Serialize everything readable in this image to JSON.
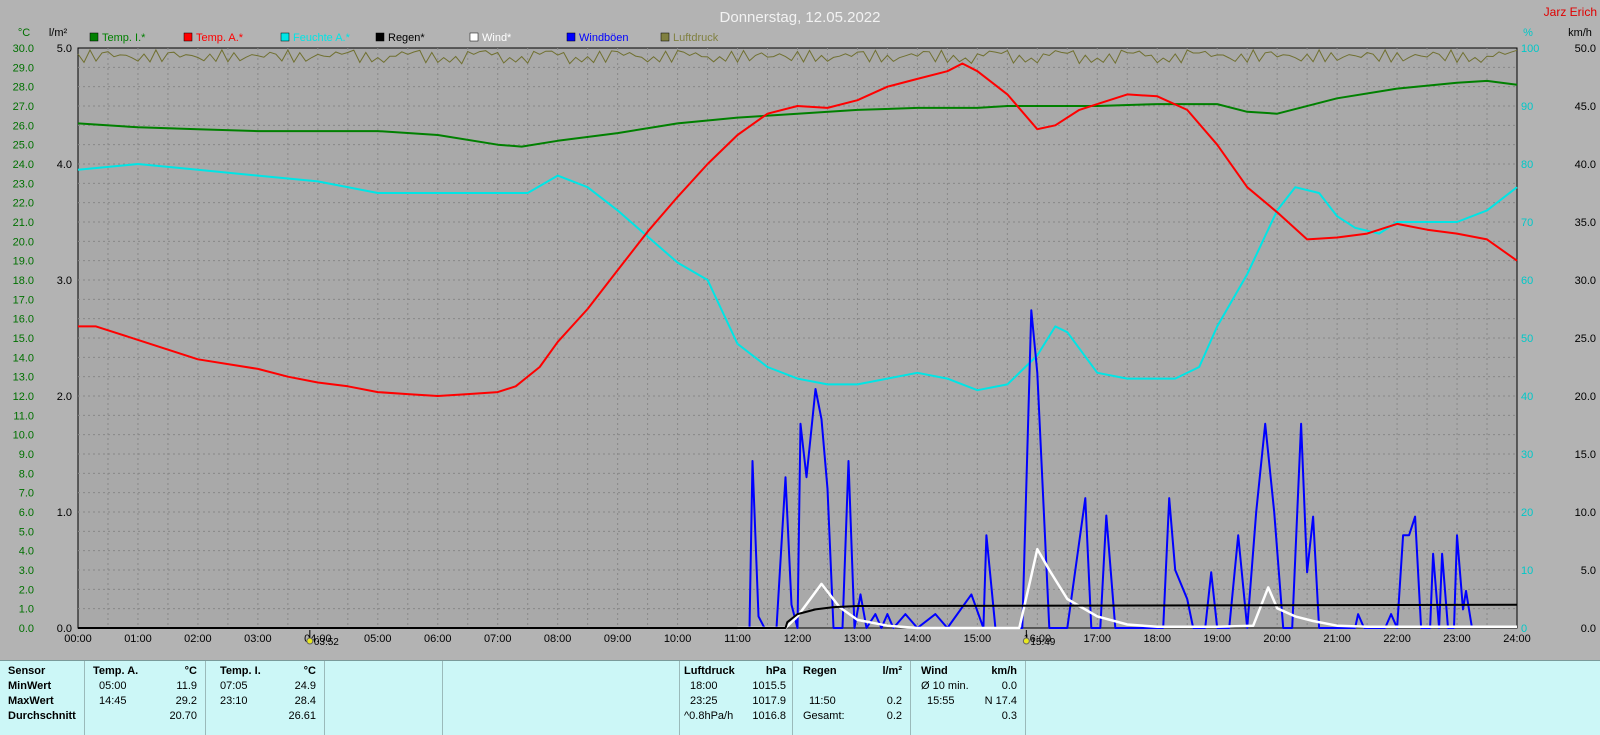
{
  "title": "Donnerstag, 12.05.2022",
  "author": "Jarz Erich",
  "units": {
    "temp": "°C",
    "rain": "l/m²",
    "humidity": "%",
    "wind": "km/h"
  },
  "legend": [
    {
      "label": "Temp. I.*",
      "color": "#008000"
    },
    {
      "label": "Temp. A.*",
      "color": "#ff0000"
    },
    {
      "label": "Feuchte A.*",
      "color": "#00e5e5"
    },
    {
      "label": "Regen*",
      "color": "#000000"
    },
    {
      "label": "Wind*",
      "color": "#ffffff"
    },
    {
      "label": "Windböen",
      "color": "#0000ff"
    },
    {
      "label": "Luftdruck",
      "color": "#808040"
    }
  ],
  "markers": [
    {
      "time": "03:52",
      "label": "03:52"
    },
    {
      "time": "15:49",
      "label": "15:49"
    }
  ],
  "chart_data": {
    "type": "line",
    "x_range": [
      "00:00",
      "24:00"
    ],
    "x_ticks": [
      "00:00",
      "01:00",
      "02:00",
      "03:00",
      "04:00",
      "05:00",
      "06:00",
      "07:00",
      "08:00",
      "09:00",
      "10:00",
      "11:00",
      "12:00",
      "13:00",
      "14:00",
      "15:00",
      "16:00",
      "17:00",
      "18:00",
      "19:00",
      "20:00",
      "21:00",
      "22:00",
      "23:00",
      "24:00"
    ],
    "axes": {
      "temp": {
        "label": "°C",
        "min": 0,
        "max": 30,
        "ticks": [
          "0.0",
          "1.0",
          "2.0",
          "3.0",
          "4.0",
          "5.0",
          "6.0",
          "7.0",
          "8.0",
          "9.0",
          "10.0",
          "11.0",
          "12.0",
          "13.0",
          "14.0",
          "15.0",
          "16.0",
          "17.0",
          "18.0",
          "19.0",
          "20.0",
          "21.0",
          "22.0",
          "23.0",
          "24.0",
          "25.0",
          "26.0",
          "27.0",
          "28.0",
          "29.0",
          "30.0"
        ]
      },
      "rain": {
        "label": "l/m²",
        "min": 0,
        "max": 5,
        "ticks": [
          "0.0",
          "1.0",
          "2.0",
          "3.0",
          "4.0",
          "5.0"
        ]
      },
      "humidity": {
        "label": "%",
        "min": 0,
        "max": 100,
        "ticks": [
          "0",
          "10",
          "20",
          "30",
          "40",
          "50",
          "60",
          "70",
          "80",
          "90",
          "100"
        ]
      },
      "wind": {
        "label": "km/h",
        "min": 0,
        "max": 50,
        "ticks": [
          "0.0",
          "5.0",
          "10.0",
          "15.0",
          "20.0",
          "25.0",
          "30.0",
          "35.0",
          "40.0",
          "45.0",
          "50.0"
        ]
      }
    },
    "grid": true,
    "series": [
      {
        "name": "Temp. I.*",
        "color": "#008000",
        "axis": "temp",
        "points": [
          [
            0,
            26.1
          ],
          [
            1,
            25.9
          ],
          [
            2,
            25.8
          ],
          [
            3,
            25.7
          ],
          [
            4,
            25.7
          ],
          [
            5,
            25.7
          ],
          [
            6,
            25.5
          ],
          [
            7,
            25.0
          ],
          [
            7.4,
            24.9
          ],
          [
            8,
            25.2
          ],
          [
            9,
            25.6
          ],
          [
            10,
            26.1
          ],
          [
            11,
            26.4
          ],
          [
            12,
            26.6
          ],
          [
            13,
            26.8
          ],
          [
            14,
            26.9
          ],
          [
            15,
            26.9
          ],
          [
            15.5,
            27.0
          ],
          [
            16,
            27.0
          ],
          [
            17,
            27.0
          ],
          [
            18,
            27.1
          ],
          [
            19,
            27.1
          ],
          [
            19.5,
            26.7
          ],
          [
            20,
            26.6
          ],
          [
            21,
            27.4
          ],
          [
            22,
            27.9
          ],
          [
            23,
            28.2
          ],
          [
            23.5,
            28.3
          ],
          [
            24,
            28.1
          ]
        ]
      },
      {
        "name": "Temp. A.*",
        "color": "#ff0000",
        "axis": "temp",
        "points": [
          [
            0,
            15.6
          ],
          [
            0.3,
            15.6
          ],
          [
            1,
            14.9
          ],
          [
            2,
            13.9
          ],
          [
            3,
            13.4
          ],
          [
            3.5,
            13.0
          ],
          [
            4,
            12.7
          ],
          [
            4.5,
            12.5
          ],
          [
            5,
            12.2
          ],
          [
            5.5,
            12.1
          ],
          [
            6,
            12.0
          ],
          [
            6.5,
            12.1
          ],
          [
            7,
            12.2
          ],
          [
            7.3,
            12.5
          ],
          [
            7.7,
            13.5
          ],
          [
            8,
            14.8
          ],
          [
            8.5,
            16.5
          ],
          [
            9,
            18.5
          ],
          [
            9.5,
            20.5
          ],
          [
            10,
            22.3
          ],
          [
            10.5,
            24.0
          ],
          [
            11,
            25.5
          ],
          [
            11.5,
            26.6
          ],
          [
            12,
            27.0
          ],
          [
            12.5,
            26.9
          ],
          [
            13,
            27.3
          ],
          [
            13.5,
            28.0
          ],
          [
            14,
            28.4
          ],
          [
            14.5,
            28.8
          ],
          [
            14.75,
            29.2
          ],
          [
            15,
            28.8
          ],
          [
            15.5,
            27.6
          ],
          [
            16,
            25.8
          ],
          [
            16.3,
            26.0
          ],
          [
            16.7,
            26.8
          ],
          [
            17,
            27.1
          ],
          [
            17.5,
            27.6
          ],
          [
            18,
            27.5
          ],
          [
            18.5,
            26.8
          ],
          [
            19,
            25.0
          ],
          [
            19.5,
            22.8
          ],
          [
            20,
            21.5
          ],
          [
            20.5,
            20.1
          ],
          [
            21,
            20.2
          ],
          [
            21.5,
            20.4
          ],
          [
            22,
            20.9
          ],
          [
            22.5,
            20.6
          ],
          [
            23,
            20.4
          ],
          [
            23.5,
            20.1
          ],
          [
            24,
            19.0
          ]
        ]
      },
      {
        "name": "Feuchte A.*",
        "color": "#00e5e5",
        "axis": "humidity",
        "points": [
          [
            0,
            79
          ],
          [
            1,
            80
          ],
          [
            2,
            79
          ],
          [
            3,
            78
          ],
          [
            4,
            77
          ],
          [
            5,
            75
          ],
          [
            6,
            75
          ],
          [
            7,
            75
          ],
          [
            7.5,
            75
          ],
          [
            8,
            78
          ],
          [
            8.5,
            76
          ],
          [
            9,
            72
          ],
          [
            10,
            63
          ],
          [
            10.5,
            60
          ],
          [
            11,
            49
          ],
          [
            11.5,
            45
          ],
          [
            12,
            43
          ],
          [
            12.5,
            42
          ],
          [
            13,
            42
          ],
          [
            13.5,
            43
          ],
          [
            14,
            44
          ],
          [
            14.5,
            43
          ],
          [
            15,
            41
          ],
          [
            15.5,
            42
          ],
          [
            16,
            47
          ],
          [
            16.3,
            52
          ],
          [
            16.5,
            51
          ],
          [
            17,
            44
          ],
          [
            17.5,
            43
          ],
          [
            18,
            43
          ],
          [
            18.3,
            43
          ],
          [
            18.7,
            45
          ],
          [
            19,
            52
          ],
          [
            19.5,
            61
          ],
          [
            20,
            72
          ],
          [
            20.3,
            76
          ],
          [
            20.7,
            75
          ],
          [
            21,
            71
          ],
          [
            21.3,
            69
          ],
          [
            21.7,
            68
          ],
          [
            22,
            70
          ],
          [
            22.5,
            70
          ],
          [
            23,
            70
          ],
          [
            23.5,
            72
          ],
          [
            24,
            76
          ]
        ]
      },
      {
        "name": "Regen*",
        "color": "#000000",
        "axis": "rain",
        "points": [
          [
            0,
            0
          ],
          [
            11.8,
            0
          ],
          [
            11.83,
            0.05
          ],
          [
            12,
            0.12
          ],
          [
            12.3,
            0.16
          ],
          [
            12.6,
            0.18
          ],
          [
            13,
            0.19
          ],
          [
            24,
            0.2
          ]
        ]
      },
      {
        "name": "Wind*",
        "color": "#ffffff",
        "axis": "wind",
        "points": [
          [
            11,
            0
          ],
          [
            11.8,
            0
          ],
          [
            12,
            1
          ],
          [
            12.4,
            3.8
          ],
          [
            12.7,
            1.8
          ],
          [
            13,
            0.7
          ],
          [
            13.5,
            0.2
          ],
          [
            14,
            0
          ],
          [
            15.7,
            0
          ],
          [
            15.9,
            4.5
          ],
          [
            16,
            6.8
          ],
          [
            16.2,
            5
          ],
          [
            16.5,
            2.5
          ],
          [
            17,
            1
          ],
          [
            17.5,
            0.3
          ],
          [
            18,
            0.1
          ],
          [
            19,
            0.1
          ],
          [
            19.6,
            0.2
          ],
          [
            19.85,
            3.5
          ],
          [
            20,
            1.7
          ],
          [
            20.3,
            1
          ],
          [
            20.6,
            0.6
          ],
          [
            21,
            0.2
          ],
          [
            21.5,
            0.1
          ],
          [
            24,
            0.1
          ]
        ]
      },
      {
        "name": "Windböen",
        "color": "#0000ff",
        "axis": "wind",
        "points": [
          [
            11.05,
            0
          ],
          [
            11.2,
            0
          ],
          [
            11.25,
            14.4
          ],
          [
            11.35,
            1
          ],
          [
            11.45,
            0
          ],
          [
            11.65,
            0
          ],
          [
            11.8,
            13
          ],
          [
            11.9,
            2
          ],
          [
            12,
            0
          ],
          [
            12.05,
            17.6
          ],
          [
            12.15,
            13
          ],
          [
            12.3,
            20.6
          ],
          [
            12.4,
            18
          ],
          [
            12.5,
            12
          ],
          [
            12.6,
            0
          ],
          [
            12.75,
            0
          ],
          [
            12.85,
            14.4
          ],
          [
            12.95,
            0
          ],
          [
            13.05,
            2.9
          ],
          [
            13.15,
            0
          ],
          [
            13.3,
            1.2
          ],
          [
            13.4,
            0
          ],
          [
            13.5,
            1.2
          ],
          [
            13.6,
            0
          ],
          [
            13.8,
            1.2
          ],
          [
            14,
            0
          ],
          [
            14.3,
            1.2
          ],
          [
            14.5,
            0
          ],
          [
            14.9,
            2.9
          ],
          [
            15.1,
            0
          ],
          [
            15.15,
            8
          ],
          [
            15.3,
            0
          ],
          [
            15.75,
            0
          ],
          [
            15.9,
            27.4
          ],
          [
            16,
            22
          ],
          [
            16.2,
            0
          ],
          [
            16.5,
            0
          ],
          [
            16.8,
            11.2
          ],
          [
            16.9,
            0
          ],
          [
            17.05,
            0
          ],
          [
            17.15,
            9.7
          ],
          [
            17.3,
            0
          ],
          [
            17.9,
            0
          ],
          [
            18.1,
            0
          ],
          [
            18.2,
            11.2
          ],
          [
            18.3,
            5
          ],
          [
            18.5,
            2.5
          ],
          [
            18.6,
            0
          ],
          [
            18.8,
            0
          ],
          [
            18.9,
            4.8
          ],
          [
            19,
            0
          ],
          [
            19.2,
            0
          ],
          [
            19.35,
            8
          ],
          [
            19.5,
            0
          ],
          [
            19.65,
            10
          ],
          [
            19.8,
            17.6
          ],
          [
            19.95,
            10
          ],
          [
            20.1,
            0
          ],
          [
            20.25,
            0
          ],
          [
            20.4,
            17.6
          ],
          [
            20.5,
            4.8
          ],
          [
            20.6,
            9.6
          ],
          [
            20.7,
            0
          ],
          [
            21.3,
            0
          ],
          [
            21.35,
            1.2
          ],
          [
            21.45,
            0
          ],
          [
            21.8,
            0
          ],
          [
            21.9,
            1.2
          ],
          [
            22,
            0
          ],
          [
            22.1,
            8
          ],
          [
            22.2,
            8
          ],
          [
            22.3,
            9.6
          ],
          [
            22.4,
            0
          ],
          [
            22.55,
            0
          ],
          [
            22.6,
            6.4
          ],
          [
            22.7,
            0
          ],
          [
            22.75,
            6.4
          ],
          [
            22.85,
            0
          ],
          [
            22.95,
            0
          ],
          [
            23,
            8
          ],
          [
            23.1,
            1.6
          ],
          [
            23.15,
            3.2
          ],
          [
            23.25,
            0
          ]
        ]
      },
      {
        "name": "Luftdruck",
        "color": "#808040",
        "axis": "top-band",
        "points": []
      }
    ]
  },
  "stats": {
    "sensor_label": "Sensor",
    "row_labels": [
      "MinWert",
      "MaxWert",
      "Durchschnitt"
    ],
    "temp_a": {
      "title": "Temp. A.",
      "unit": "°C",
      "min_time": "05:00",
      "min": "11.9",
      "max_time": "14:45",
      "max": "29.2",
      "avg": "20.70"
    },
    "temp_i": {
      "title": "Temp. I.",
      "unit": "°C",
      "min_time": "07:05",
      "min": "24.9",
      "max_time": "23:10",
      "max": "28.4",
      "avg": "26.61"
    },
    "pressure": {
      "title": "Luftdruck",
      "unit": "hPa",
      "r1_a": "18:00",
      "r1_b": "1015.5",
      "r2_a": "23:25",
      "r2_b": "1017.9",
      "r3_a": "^0.8hPa/h",
      "r3_b": "1016.8"
    },
    "rain": {
      "title": "Regen",
      "unit": "l/m²",
      "r2_a": "11:50",
      "r2_b": "0.2",
      "r3_a": "Gesamt:",
      "r3_b": "0.2"
    },
    "wind": {
      "title": "Wind",
      "unit": "km/h",
      "r1_a": "Ø 10 min.",
      "r1_b": "0.0",
      "r2_a": "15:55",
      "r2_b": "N 17.4",
      "r3_b": "0.3"
    }
  }
}
